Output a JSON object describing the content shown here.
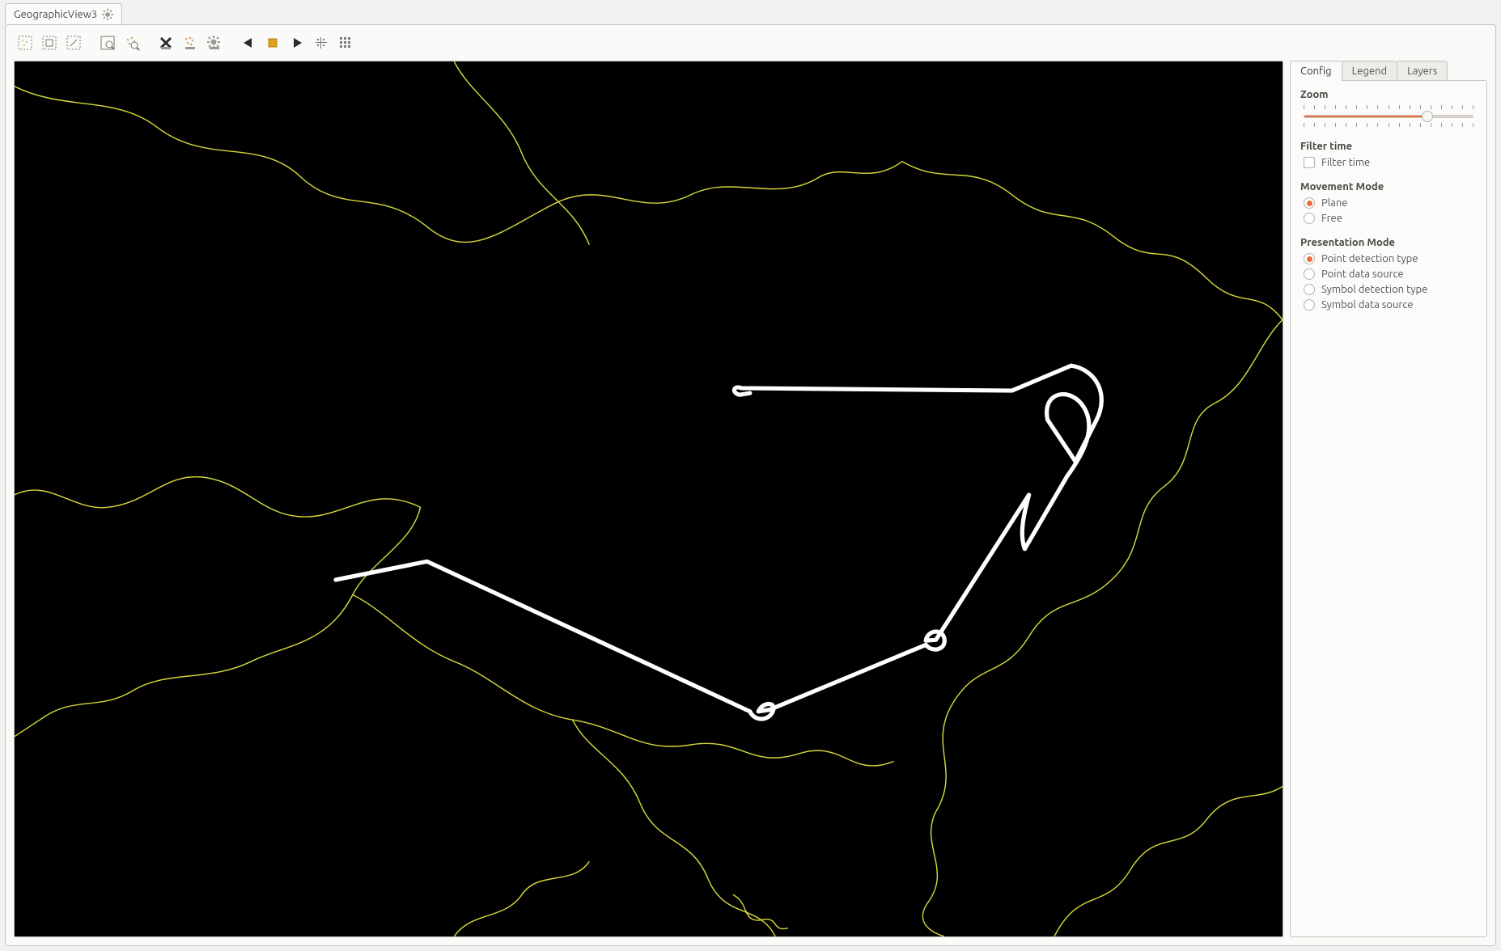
{
  "window": {
    "tab_title": "GeographicView3"
  },
  "toolbar_icons": [
    "select-area-icon",
    "select-rect-icon",
    "select-marquee-icon",
    "zoom-extent-icon",
    "scatter-icon",
    "|",
    "clear-x-icon",
    "filter-points-icon",
    "gear-icon",
    "|",
    "play-back-icon",
    "stop-icon",
    "play-forward-icon",
    "step-icon",
    "grid-icon"
  ],
  "side": {
    "tabs": {
      "config": "Config",
      "legend": "Legend",
      "layers": "Layers",
      "active": "config"
    },
    "zoom": {
      "title": "Zoom",
      "value_pct": 73,
      "ticks": 17
    },
    "filter_time": {
      "title": "Filter time",
      "checkbox_label": "Filter time",
      "checked": false
    },
    "movement_mode": {
      "title": "Movement Mode",
      "options": [
        {
          "label": "Plane",
          "selected": true
        },
        {
          "label": "Free",
          "selected": false
        }
      ]
    },
    "presentation_mode": {
      "title": "Presentation Mode",
      "options": [
        {
          "label": "Point detection type",
          "selected": true
        },
        {
          "label": "Point data source",
          "selected": false
        },
        {
          "label": "Symbol detection type",
          "selected": false
        },
        {
          "label": "Symbol data source",
          "selected": false
        }
      ]
    }
  },
  "map": {
    "background": "#000000",
    "border_color": "#d4d53b",
    "track_color": "#ffffff",
    "description": "Map of Austria with a white GPS/flight track polyline crossing the country"
  }
}
